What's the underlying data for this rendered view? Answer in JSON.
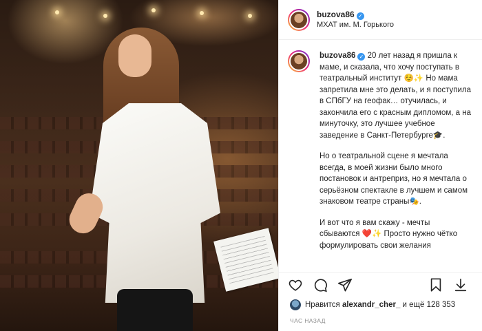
{
  "post": {
    "username": "buzova86",
    "location": "МХАТ им. М. Горького",
    "verified_glyph": "✓"
  },
  "caption": {
    "username": "buzova86",
    "paragraphs": [
      "20 лет назад я пришла к маме, и сказала, что хочу поступать в театральный институт ☺️✨ Но мама запретила мне это делать, и я поступила в СПбГУ на геофак… отучилась, и закончила его с красным дипломом, а на минуточку, это лучшее учебное заведение в Санкт-Петербурге🎓.",
      "Но о театральной сцене я мечтала всегда, в моей жизни было много постановок и антреприз, но я мечтала о серьёзном спектакле в лучшем и самом знаковом театре страны🎭.",
      "И вот что я вам скажу - мечты сбываются ❤️✨ Просто нужно чётко формулировать свои желания"
    ]
  },
  "actions": {
    "like_icon": "heart-icon",
    "comment_icon": "comment-icon",
    "share_icon": "share-icon",
    "save_icon": "bookmark-icon",
    "download_icon": "download-icon"
  },
  "likes": {
    "prefix": "Нравится",
    "user": "alexandr_cher_",
    "suffix": "и ещё 128 353"
  },
  "timestamp": "час назад",
  "colors": {
    "verified": "#3897f0",
    "text": "#262626",
    "muted": "#8e8e8e"
  }
}
